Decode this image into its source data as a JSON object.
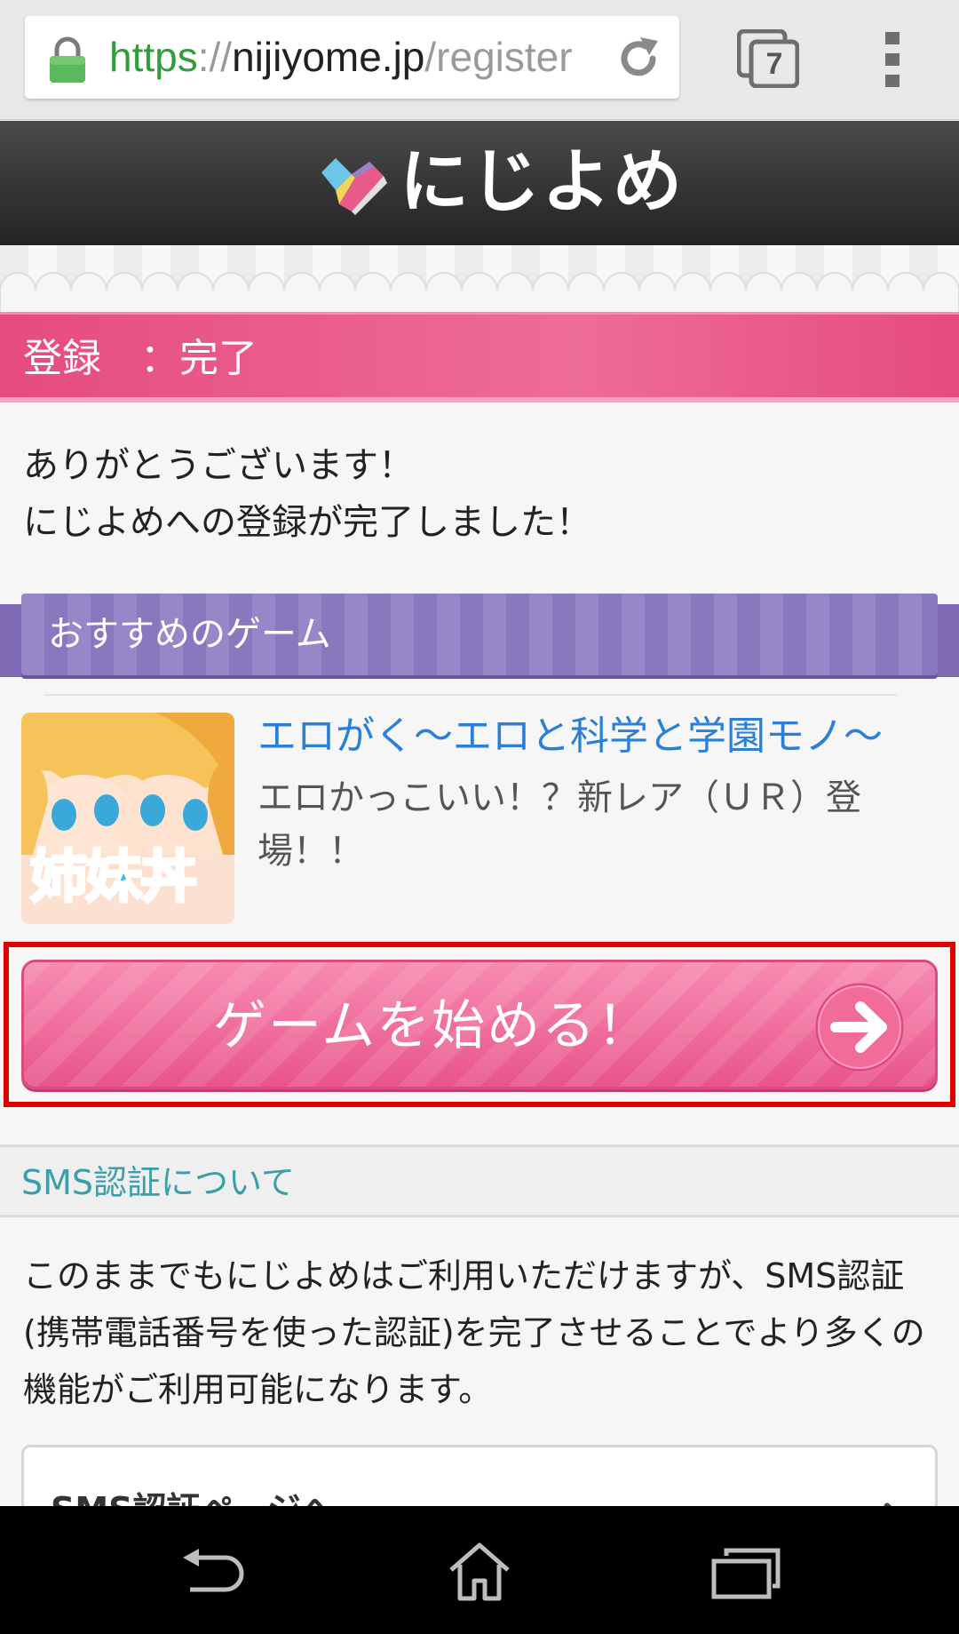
{
  "browser": {
    "url_scheme": "https",
    "url_sep": "://",
    "url_host": "nijiyome.jp",
    "url_path": "/register",
    "tab_count": "7",
    "icons": [
      "lock-icon",
      "reload-icon",
      "tabs-icon",
      "overflow-menu-icon"
    ]
  },
  "site": {
    "logo_text": "にじよめ",
    "logo_icon": "heart-logo-icon"
  },
  "page": {
    "heading": "登録　：完了",
    "thanks_line1": "ありがとうございます！",
    "thanks_line2": "にじよめへの登録が完了しました！"
  },
  "recommend": {
    "ribbon_label": "おすすめのゲーム",
    "game_title": "エロがく～エロと科学と学園モノ～",
    "game_desc": "エロかっこいい！？新レア（ＵＲ）登場！！",
    "thumb_caption": "姉妹丼"
  },
  "start_button": {
    "label": "ゲームを始める！",
    "icon": "arrow-right-icon"
  },
  "sms": {
    "heading": "SMS認証について",
    "body": "このままでもにじよめはご利用いただけますが、SMS認証(携帯電話番号を使った認証)を完了させることでより多くの機能がご利用可能になります。",
    "link_label": "SMS認証ページへ"
  },
  "colors": {
    "header_bg": "#2f2f2f",
    "pink_accent": "#e64b81",
    "purple_ribbon": "#8a78bf",
    "link_blue": "#2a7fd8",
    "sms_teal": "#3a9fa8",
    "highlight_red": "#e00000"
  },
  "nav": {
    "icons": [
      "back-icon",
      "home-icon",
      "recent-apps-icon"
    ]
  }
}
